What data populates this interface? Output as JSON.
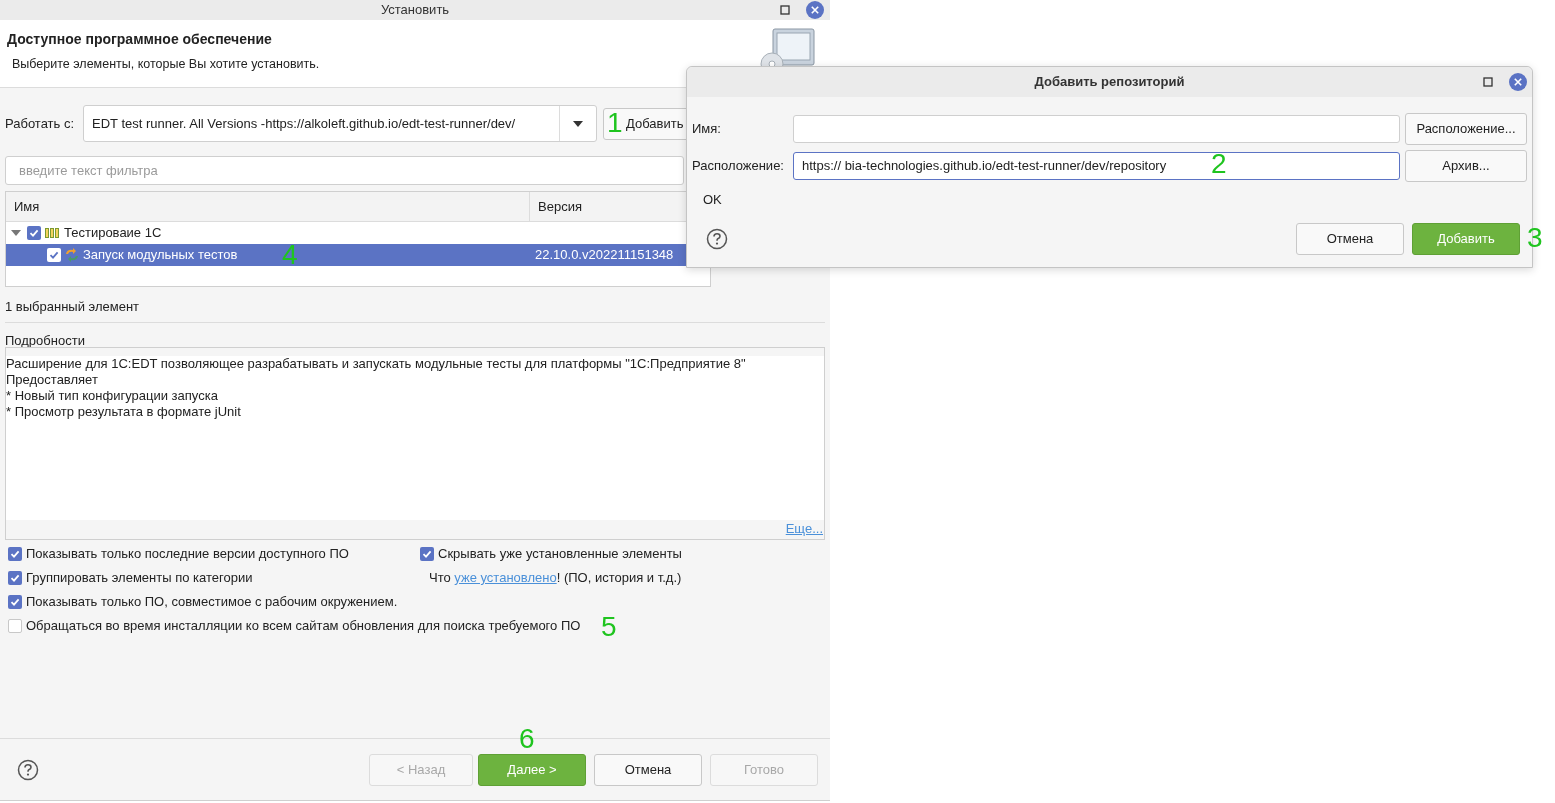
{
  "main_window": {
    "title": "Установить",
    "header": {
      "title": "Доступное программное обеспечение",
      "subtitle": "Выберите элементы, которые Вы хотите установить."
    },
    "work_with": {
      "label": "Работать с:",
      "value": "EDT test runner. All Versions -https://alkoleft.github.io/edt-test-runner/dev/",
      "add_button": "Добавить"
    },
    "filter": {
      "placeholder": "введите текст фильтра"
    },
    "table": {
      "columns": [
        "Имя",
        "Версия"
      ],
      "rows": [
        {
          "name": "Тестироваие 1С",
          "kind": "category",
          "checked": true,
          "expanded": true,
          "selected": false,
          "children": [
            {
              "name": "Запуск модульных тестов",
              "kind": "feature",
              "version": "22.10.0.v202211151348",
              "checked": true,
              "selected": true
            }
          ]
        }
      ]
    },
    "selection_count": "1 выбранный элемент",
    "details": {
      "label": "Подробности",
      "lines": [
        "Расширение для 1С:EDT позволяющее разрабатывать и запускать модульные тесты для платформы \"1С:Предприятие 8\"",
        "Предоставляет",
        "* Новый тип конфигурации запуска",
        "* Просмотр результата в формате jUnit"
      ],
      "more_link": "Еще..."
    },
    "options": [
      {
        "label": "Показывать только последние версии доступного ПО",
        "checked": true
      },
      {
        "label": "Группировать элементы по категории",
        "checked": true
      },
      {
        "label": "Показывать только ПО, совместимое с рабочим окружением.",
        "checked": true
      },
      {
        "label": "Обращаться во время инсталляции ко всем сайтам обновления для поиска требуемого ПО",
        "checked": false
      }
    ],
    "side_option": {
      "label": "Скрывать уже установленные элементы",
      "checked": true
    },
    "installed_note": {
      "before": "Что",
      "link": "уже установлено",
      "after": "! (ПО, история и т.д.)"
    },
    "buttons": [
      {
        "label": "< Назад",
        "kind": "default",
        "disabled": true
      },
      {
        "label": "Далее >",
        "kind": "primary",
        "disabled": false
      },
      {
        "label": "Отмена",
        "kind": "default",
        "disabled": false
      },
      {
        "label": "Готово",
        "kind": "default",
        "disabled": true
      }
    ]
  },
  "dialog": {
    "title": "Добавить репозиторий",
    "fields": [
      {
        "label": "Имя:",
        "focused": false,
        "button": "Расположение..."
      },
      {
        "label": "Расположение:",
        "value": "https:// bia-technologies.github.io/edt-test-runner/dev/repository",
        "focused": true,
        "button": "Архив..."
      }
    ],
    "status": "OK",
    "buttons": [
      {
        "label": "Отмена",
        "kind": "default",
        "disabled": false
      },
      {
        "label": "Добавить",
        "kind": "primary",
        "disabled": false
      }
    ]
  },
  "annotations": [
    "1",
    "2",
    "3",
    "4",
    "5",
    "6"
  ]
}
